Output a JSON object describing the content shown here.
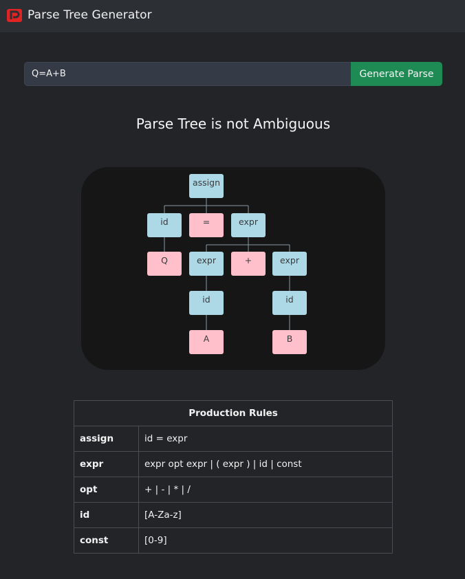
{
  "app": {
    "title": "Parse Tree Generator",
    "logo_color": "#e02424"
  },
  "input": {
    "value": "Q=A+B",
    "button_label": "Generate Parse",
    "button_color": "#1e8a54"
  },
  "result": {
    "title": "Parse Tree is not Ambiguous"
  },
  "tree": {
    "colors": {
      "nonterminal": "#add8e6",
      "terminal": "#ffc0cb",
      "edge": "#8a9aa5"
    },
    "nodes": [
      {
        "id": "n0",
        "label": "assign",
        "kind": "nonterminal"
      },
      {
        "id": "n1",
        "label": "id",
        "kind": "nonterminal"
      },
      {
        "id": "n2",
        "label": "=",
        "kind": "terminal"
      },
      {
        "id": "n3",
        "label": "expr",
        "kind": "nonterminal"
      },
      {
        "id": "n4",
        "label": "Q",
        "kind": "terminal"
      },
      {
        "id": "n5",
        "label": "expr",
        "kind": "nonterminal"
      },
      {
        "id": "n6",
        "label": "+",
        "kind": "terminal"
      },
      {
        "id": "n7",
        "label": "expr",
        "kind": "nonterminal"
      },
      {
        "id": "n8",
        "label": "id",
        "kind": "nonterminal"
      },
      {
        "id": "n9",
        "label": "id",
        "kind": "nonterminal"
      },
      {
        "id": "n10",
        "label": "A",
        "kind": "terminal"
      },
      {
        "id": "n11",
        "label": "B",
        "kind": "terminal"
      }
    ]
  },
  "rules": {
    "header": "Production Rules",
    "rows": [
      {
        "lhs": "assign",
        "rhs": "id = expr"
      },
      {
        "lhs": "expr",
        "rhs": "expr opt expr | ( expr ) | id | const"
      },
      {
        "lhs": "opt",
        "rhs": "+ | - | * | /"
      },
      {
        "lhs": "id",
        "rhs": "[A-Za-z]"
      },
      {
        "lhs": "const",
        "rhs": "[0-9]"
      }
    ]
  }
}
